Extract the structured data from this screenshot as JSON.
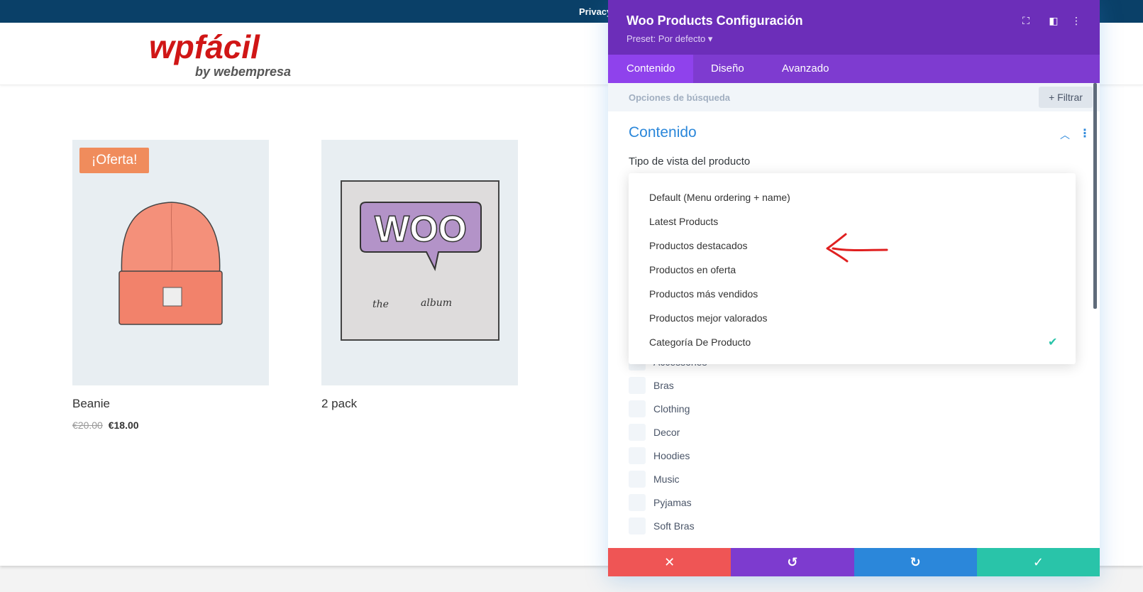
{
  "site": {
    "topbar_link": "Privacy",
    "logo": {
      "main": "wpfácil",
      "sub": "by webempresa"
    },
    "products": [
      {
        "name": "Beanie",
        "badge": "¡Oferta!",
        "price_old": "€20.00",
        "price_new": "€18.00",
        "image": "beanie-image"
      },
      {
        "name": "2 pack",
        "image": "woo-album-image",
        "art_text": "WOO",
        "art_caption_left": "the",
        "art_caption_right": "album"
      }
    ]
  },
  "panel": {
    "title": "Woo Products Configuración",
    "preset": "Preset: Por defecto ▾",
    "tabs": [
      {
        "label": "Contenido",
        "active": true
      },
      {
        "label": "Diseño",
        "active": false
      },
      {
        "label": "Avanzado",
        "active": false
      }
    ],
    "search_placeholder": "Opciones de búsqueda",
    "filter_label": "+ Filtrar",
    "section_title": "Contenido",
    "field_label": "Tipo de vista del producto",
    "dropdown_options": [
      "Default (Menu ordering + name)",
      "Latest Products",
      "Productos destacados",
      "Productos en oferta",
      "Productos más vendidos",
      "Productos mejor valorados",
      "Categoría De Producto"
    ],
    "selected_option_index": 6,
    "categories": [
      "Accessories",
      "Bras",
      "Clothing",
      "Decor",
      "Hoodies",
      "Music",
      "Pyjamas",
      "Soft Bras"
    ],
    "colors": {
      "header": "#6c2eb9",
      "tabs": "#7e3bd0",
      "accent_blue": "#2b87da",
      "check": "#29c4a9",
      "cancel": "#ef5555",
      "undo": "#7d3bcf",
      "redo": "#2b87da",
      "save": "#29c4a9"
    }
  },
  "annotation": {
    "type": "red-hand-drawn-arrow",
    "color": "#e02020"
  }
}
